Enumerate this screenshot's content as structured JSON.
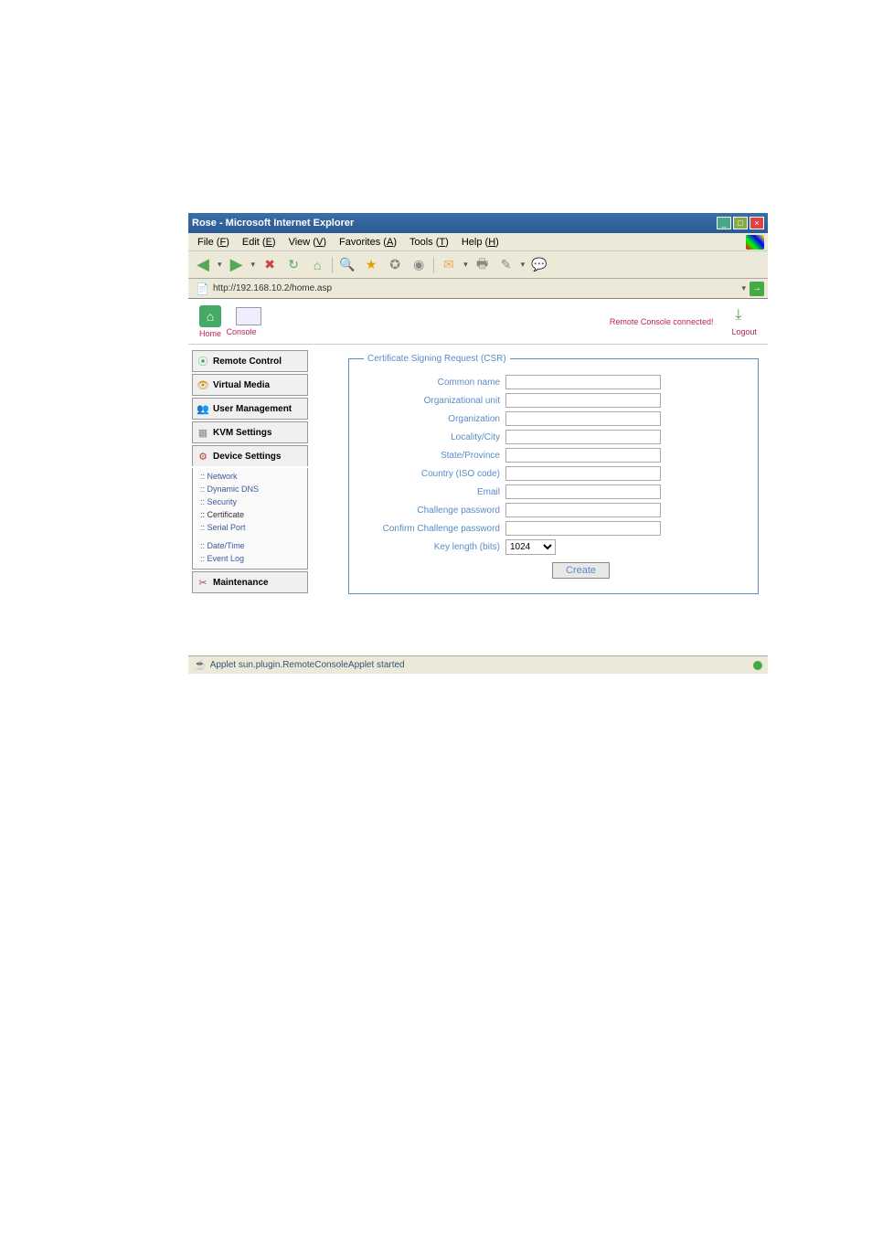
{
  "window": {
    "title": "Rose - Microsoft Internet Explorer"
  },
  "menu": {
    "file": "File",
    "file_key": "F",
    "edit": "Edit",
    "edit_key": "E",
    "view": "View",
    "view_key": "V",
    "favorites": "Favorites",
    "favorites_key": "A",
    "tools": "Tools",
    "tools_key": "T",
    "help": "Help",
    "help_key": "H"
  },
  "addr": {
    "label": "",
    "url": "http://192.168.10.2/home.asp"
  },
  "top": {
    "home": "Home",
    "console": "Console",
    "status": "Remote Console connected!",
    "logout": "Logout"
  },
  "nav": {
    "remote_control": "Remote Control",
    "virtual_media": "Virtual Media",
    "user_management": "User Management",
    "kvm_settings": "KVM Settings",
    "device_settings": "Device Settings",
    "maintenance": "Maintenance"
  },
  "subnav": {
    "network": "Network",
    "dynamic_dns": "Dynamic DNS",
    "security": "Security",
    "certificate": "Certificate",
    "serial_port": "Serial Port",
    "date_time": "Date/Time",
    "event_log": "Event Log"
  },
  "form": {
    "legend": "Certificate Signing Request (CSR)",
    "common_name": "Common name",
    "org_unit": "Organizational unit",
    "organization": "Organization",
    "locality": "Locality/City",
    "state": "State/Province",
    "country": "Country (ISO code)",
    "email": "Email",
    "challenge_pw": "Challenge password",
    "confirm_pw": "Confirm Challenge password",
    "key_length": "Key length (bits)",
    "key_length_val": "1024",
    "create_btn": "Create"
  },
  "statusbar": {
    "text": "Applet sun.plugin.RemoteConsoleApplet started"
  }
}
